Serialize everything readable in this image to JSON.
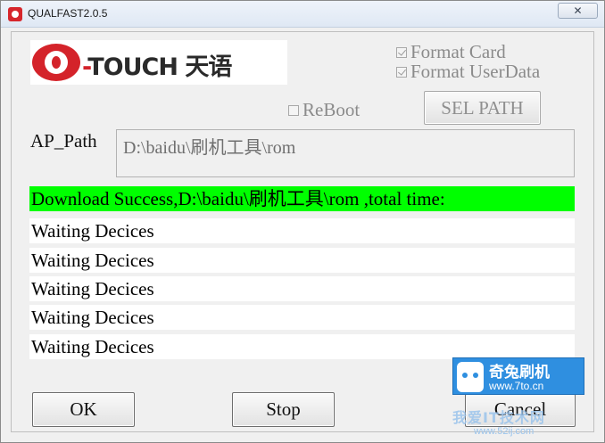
{
  "window": {
    "title": "QUALFAST2.0.5",
    "close_glyph": "✕"
  },
  "logo": {
    "prefix": "-",
    "text": "TOUCH 天语"
  },
  "options": {
    "format_card": {
      "label": "Format Card",
      "checked": true
    },
    "format_userdata": {
      "label": "Format UserData",
      "checked": true
    },
    "reboot": {
      "label": "ReBoot",
      "checked": false
    }
  },
  "sel_path_button": "SEL PATH",
  "ap_path": {
    "label": "AP_Path",
    "value": "D:\\baidu\\刷机工具\\rom"
  },
  "status": [
    {
      "text": "Download Success,D:\\baidu\\刷机工具\\rom ,total time:",
      "state": "success"
    },
    {
      "text": "Waiting Decices",
      "state": "waiting"
    },
    {
      "text": "Waiting Decices",
      "state": "waiting"
    },
    {
      "text": "Waiting Decices",
      "state": "waiting"
    },
    {
      "text": "Waiting Decices",
      "state": "waiting"
    },
    {
      "text": "Waiting Decices",
      "state": "waiting"
    }
  ],
  "buttons": {
    "ok": "OK",
    "stop": "Stop",
    "cancel": "Cancel"
  },
  "watermark": {
    "name": "奇兔刷机",
    "url": "www.7to.cn",
    "caption": "我爱IT技术网",
    "caption_url": "www.52ij.com"
  },
  "colors": {
    "success": "#00ff00",
    "brand_red": "#d4232a",
    "watermark_blue": "#2f8fe0"
  },
  "icons": {
    "app": "app-icon",
    "close": "close-icon",
    "checkbox": "checkbox-icon"
  }
}
